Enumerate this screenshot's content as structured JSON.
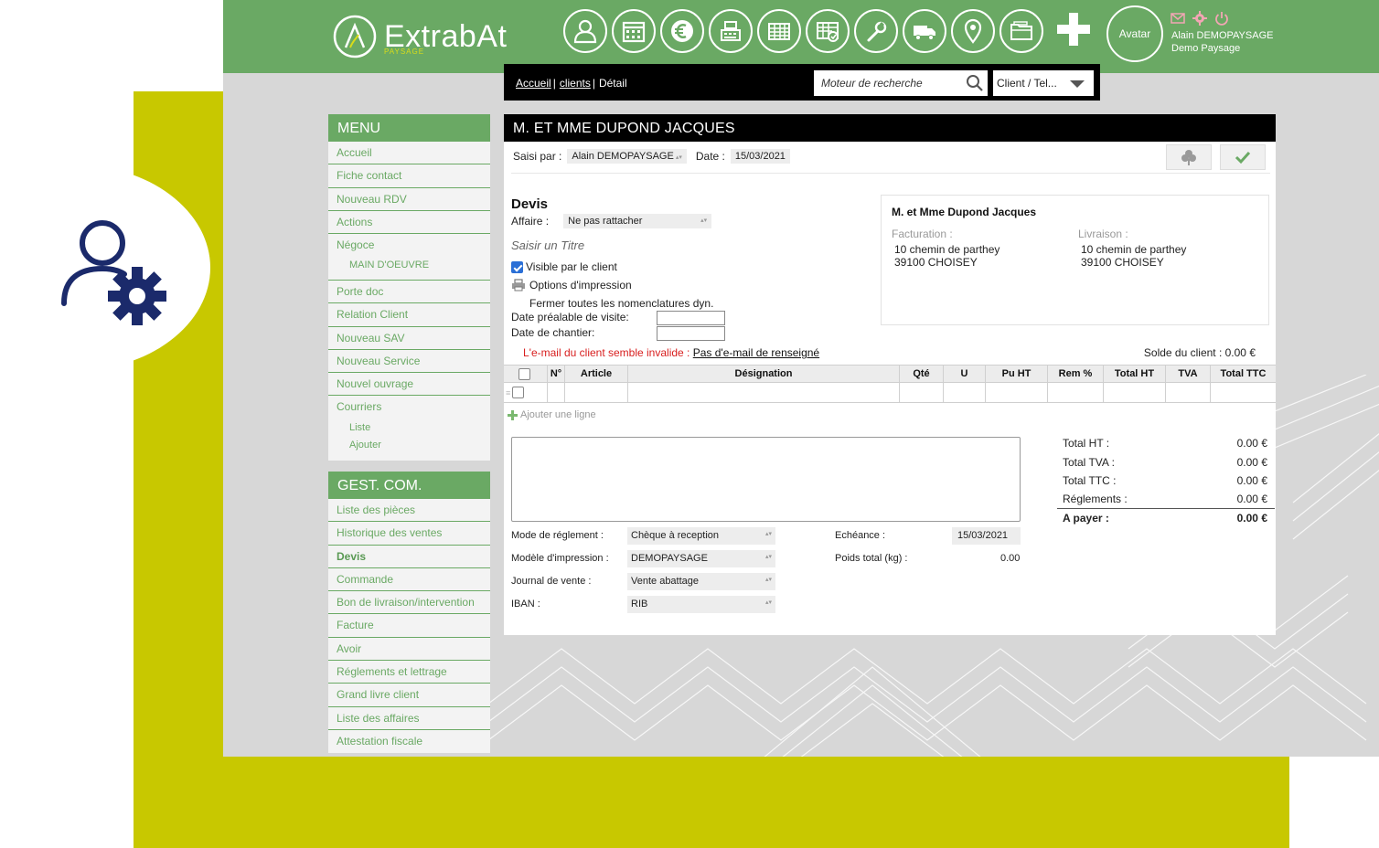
{
  "app": {
    "logo_text": "ExtrabAt",
    "logo_sub": "PAYSAGE",
    "avatar_label": "Avatar",
    "user_name": "Alain DEMOPAYSAGE",
    "company": "Demo Paysage",
    "nav_icons": [
      "contact-icon",
      "calendar-icon",
      "euro-icon",
      "cash-register-icon",
      "spreadsheet-icon",
      "planning-icon",
      "wrench-icon",
      "truck-icon",
      "location-pin-icon",
      "folder-icon"
    ],
    "colors": {
      "header_green": "#6aa964",
      "accent_yellow": "#c8c800",
      "error_red": "#d81e1e"
    }
  },
  "breadcrumb": {
    "home": "Accueil",
    "clients": "clients",
    "current": "Détail"
  },
  "search": {
    "placeholder": "Moteur de recherche",
    "scope": "Client / Tel..."
  },
  "sidebar": {
    "menu_title": "MENU",
    "menu_items": {
      "accueil": "Accueil",
      "fiche_contact": "Fiche contact",
      "nouveau_rdv": "Nouveau RDV",
      "actions": "Actions",
      "negoce": "Négoce",
      "main_oeuvre": "MAIN D'OEUVRE",
      "porte_doc": "Porte doc",
      "relation_client": "Relation Client",
      "nouveau_sav": "Nouveau SAV",
      "nouveau_service": "Nouveau Service",
      "nouvel_ouvrage": "Nouvel ouvrage",
      "courriers": "Courriers",
      "liste": "Liste",
      "ajouter": "Ajouter"
    },
    "gest_title": "GEST. COM.",
    "gest_items": {
      "liste_pieces": "Liste des pièces",
      "historique": "Historique des ventes",
      "devis": "Devis",
      "commande": "Commande",
      "bon_livraison": "Bon de livraison/intervention",
      "facture": "Facture",
      "avoir": "Avoir",
      "reglements": "Réglements et lettrage",
      "grand_livre": "Grand livre client",
      "liste_affaires": "Liste des affaires",
      "attestation": "Attestation fiscale"
    }
  },
  "document": {
    "title": "M. ET MME DUPOND JACQUES",
    "saisi_par_label": "Saisi par :",
    "saisi_par_value": "Alain DEMOPAYSAGE",
    "date_label": "Date :",
    "date_value": "15/03/2021",
    "type_heading": "Devis",
    "affaire_label": "Affaire :",
    "affaire_value": "Ne pas rattacher",
    "title_placeholder": "Saisir un Titre",
    "visible_label": "Visible par le client",
    "visible_checked": true,
    "print_options": "Options d'impression",
    "close_nomenclatures": "Fermer toutes les nomenclatures dyn.",
    "date_visite_label": "Date préalable de visite:",
    "date_chantier_label": "Date de chantier:",
    "email_warning": "L'e-mail du client semble invalide :",
    "email_link": "Pas d'e-mail de renseigné",
    "solde_label": "Solde du client : 0.00 €"
  },
  "client": {
    "name": "M. et Mme Dupond Jacques",
    "facturation_label": "Facturation :",
    "facturation_line1": "10 chemin de parthey",
    "facturation_line2": "39100 CHOISEY",
    "livraison_label": "Livraison :",
    "livraison_line1": "10 chemin de parthey",
    "livraison_line2": "39100 CHOISEY"
  },
  "table": {
    "columns": [
      "N°",
      "Article",
      "Désignation",
      "Qté",
      "U",
      "Pu HT",
      "Rem %",
      "Total HT",
      "TVA",
      "Total TTC"
    ],
    "add_line": "Ajouter une ligne"
  },
  "footer_fields": {
    "mode_label": "Mode de réglement :",
    "mode_value": "Chèque à reception",
    "modele_label": "Modèle d'impression :",
    "modele_value": "DEMOPAYSAGE",
    "journal_label": "Journal de vente :",
    "journal_value": "Vente abattage",
    "iban_label": "IBAN :",
    "iban_value": "RIB",
    "echeance_label": "Echéance :",
    "echeance_value": "15/03/2021",
    "poids_label": "Poids total (kg) :",
    "poids_value": "0.00"
  },
  "totals": {
    "ht_label": "Total HT :",
    "ht": "0.00 €",
    "tva_label": "Total TVA :",
    "tva": "0.00 €",
    "ttc_label": "Total TTC :",
    "ttc": "0.00 €",
    "reg_label": "Réglements :",
    "reg": "0.00 €",
    "pay_label": "A payer :",
    "pay": "0.00 €"
  }
}
